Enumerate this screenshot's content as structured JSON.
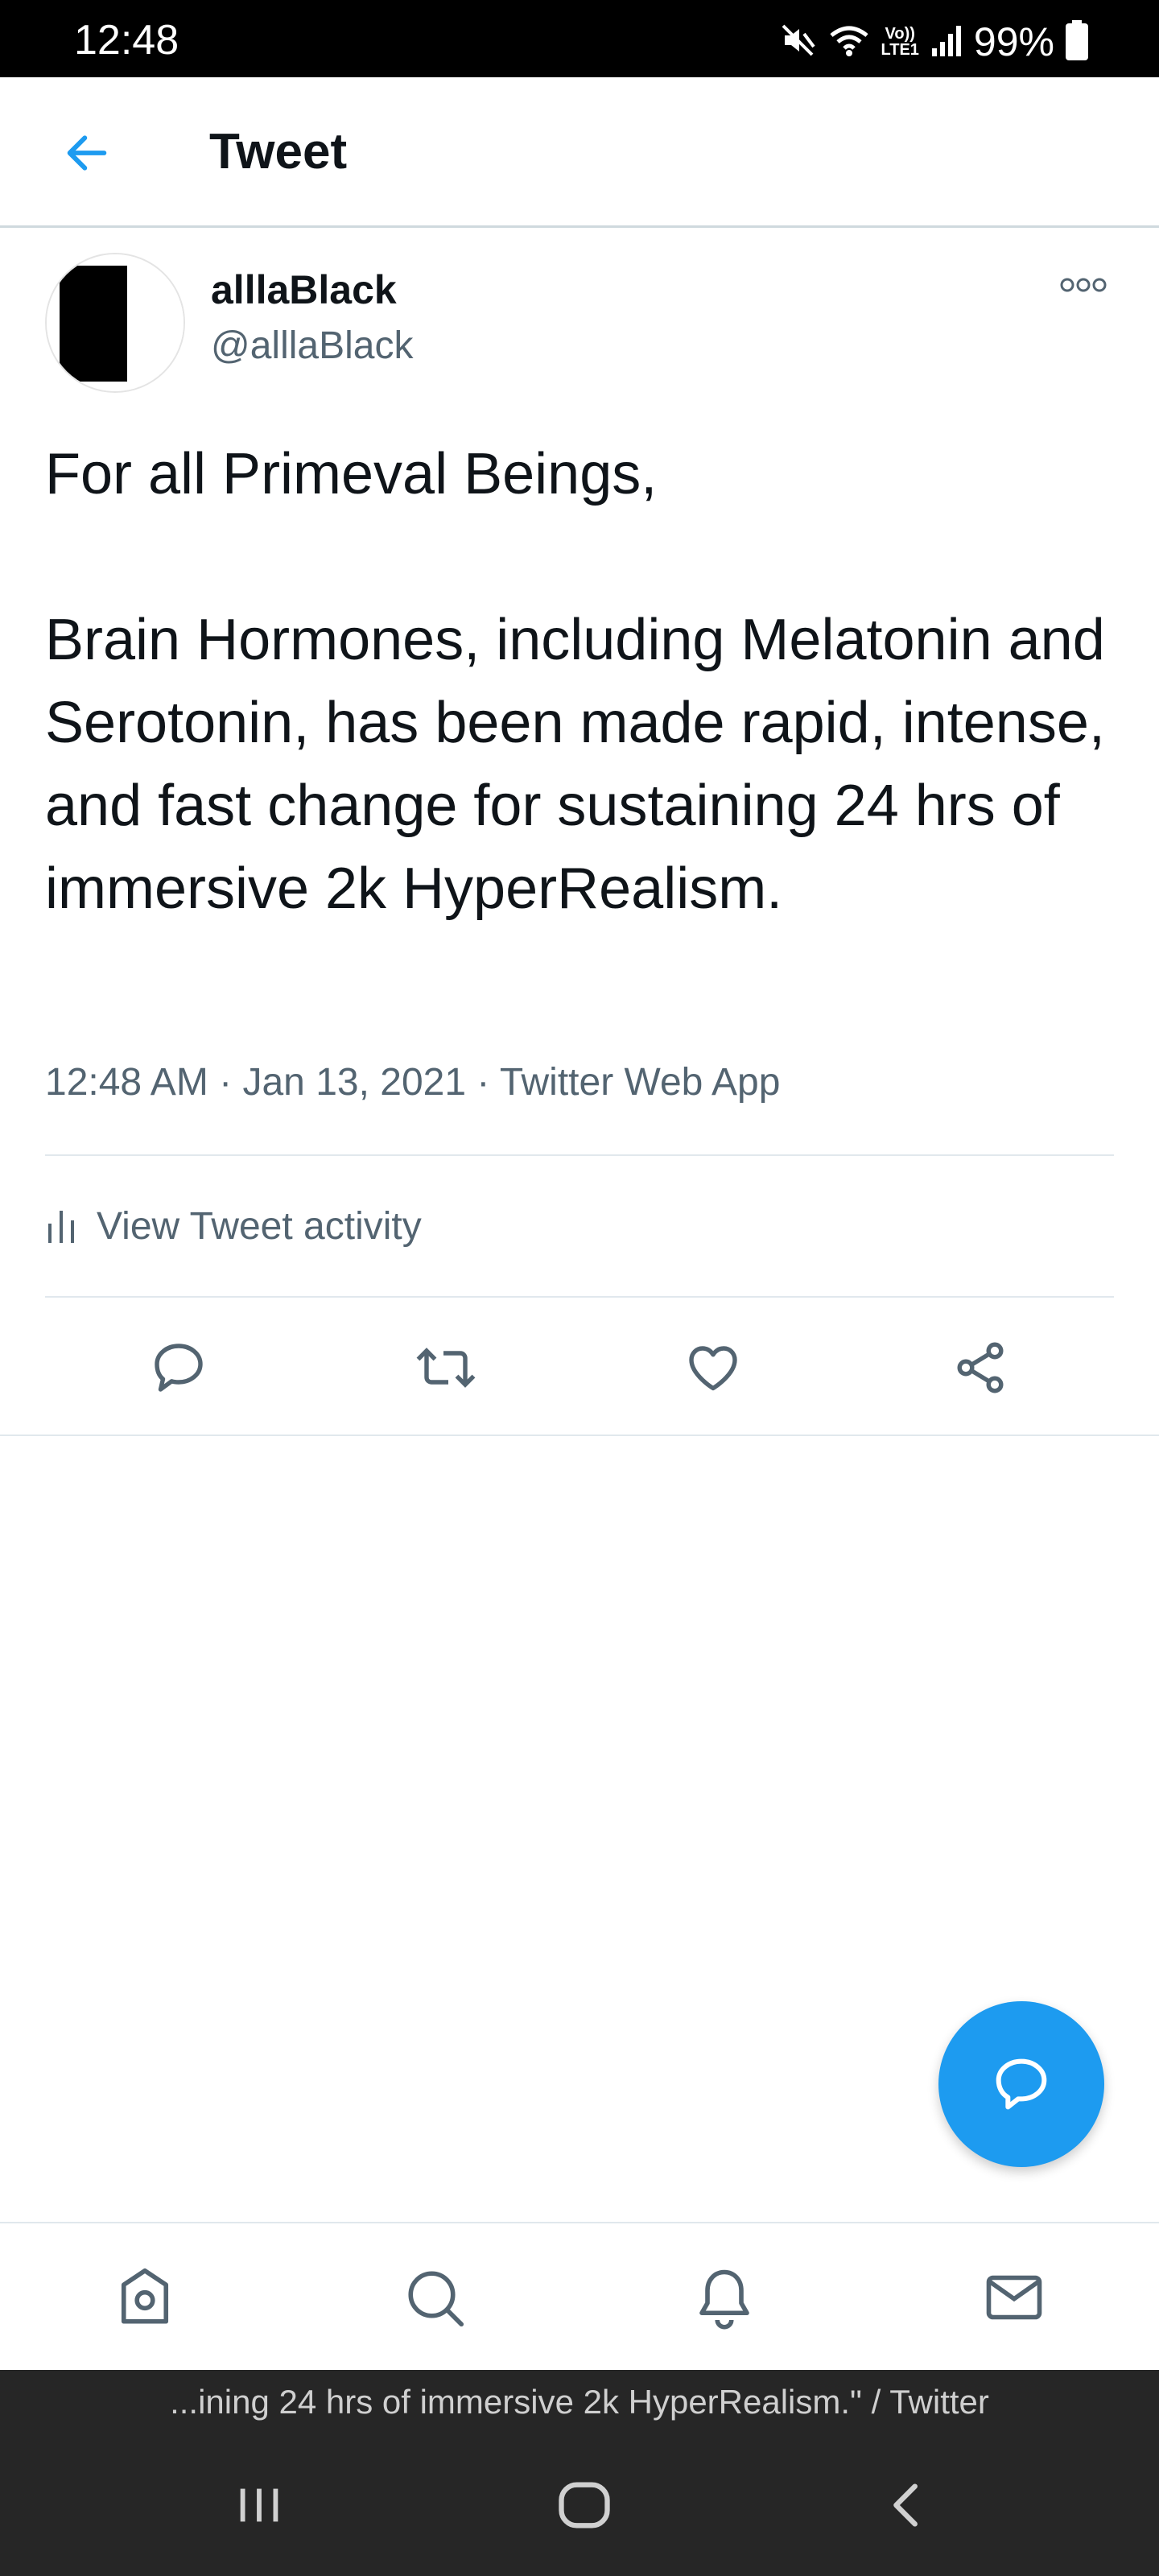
{
  "status_bar": {
    "time": "12:48",
    "lte_top": "Vo))",
    "lte_bottom": "LTE1",
    "battery": "99%",
    "icons": [
      "mute-icon",
      "wifi-icon",
      "signal-icon",
      "battery-icon"
    ]
  },
  "header": {
    "back_icon": "back-arrow-icon",
    "title": "Tweet"
  },
  "tweet": {
    "display_name": "alllaBlack",
    "handle": "@alllaBlack",
    "more_icon": "more-options-icon",
    "text": "For all Primeval Beings,\n\nBrain Hormones, including Melatonin and Serotonin, has been made rapid, intense, and fast change for sustaining 24 hrs of immersive 2k HyperRealism.",
    "meta": "12:48 AM · Jan 13, 2021 · Twitter Web App",
    "activity_label": "View Tweet activity",
    "actions": [
      "reply-icon",
      "retweet-icon",
      "like-icon",
      "share-icon"
    ]
  },
  "fab": {
    "icon": "compose-reply-icon",
    "color": "#1d9bf0"
  },
  "bottom_nav": {
    "items": [
      "home-icon",
      "search-icon",
      "notifications-icon",
      "messages-icon"
    ]
  },
  "browser": {
    "url_text": "...ining 24 hrs of immersive 2k HyperRealism.\" / Twitter"
  },
  "system_nav": {
    "items": [
      "recent-apps-icon",
      "home-button-icon",
      "back-icon"
    ]
  },
  "colors": {
    "accent": "#1d9bf0",
    "secondary_text": "#536471",
    "text": "#0f1419"
  }
}
